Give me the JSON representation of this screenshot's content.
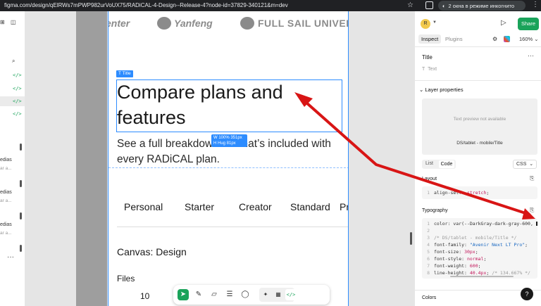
{
  "browser": {
    "url": "figma.com/design/qElRWs7mPWP982urVoUX75/RADiCAL-4-Design--Release-4?node-id=37829-340121&m=dev",
    "incognito_label": "2 окна в режиме инкогнито",
    "star_icon": "star-icon",
    "menu_icon": "kebab-icon"
  },
  "left_panel": {
    "code_icon": "</>",
    "truncated_rows": [
      {
        "title": "edias",
        "sub": "ar a..."
      },
      {
        "title": "edias",
        "sub": "ar a..."
      },
      {
        "title": "edias",
        "sub": "ar a..."
      }
    ]
  },
  "artboard": {
    "logos": [
      "enter",
      "Yanfeng",
      "FULL SAIL UNIVERS"
    ],
    "title_tag": "T Title",
    "title": "Compare plans and features",
    "dimension_badge": {
      "line1": "W 100%  351px",
      "line2": "H  Hug     81px"
    },
    "subtitle": "See a full breakdown of what’s included with every RADiCAL plan.",
    "plans": [
      "Personal",
      "Starter",
      "Creator",
      "Standard",
      "Pr"
    ],
    "canvas_heading": "Canvas: Design",
    "files_heading": "Files",
    "files_value": "10",
    "infinity": "∞"
  },
  "toolbar": {
    "tools": [
      "cursor-icon",
      "pen-icon",
      "ruler-icon",
      "comment-list-icon",
      "comment-icon",
      "ai-icon",
      "component-icon",
      "code-icon"
    ],
    "code_label": "</>"
  },
  "right_panel": {
    "avatar_letter": "R",
    "share_label": "Share",
    "tabs": {
      "inspect": "Inspect",
      "plugins": "Plugins"
    },
    "zoom": "160%",
    "layer_title": "Title",
    "layer_type": "Text",
    "layer_properties": "Layer properties",
    "preview_unavailable": "Text preview not available",
    "preview_name": "DS/tablet - mobile/Title",
    "view_list": "List",
    "view_code": "Code",
    "lang": "CSS",
    "layout_label": "Layout",
    "layout_code": [
      {
        "n": "1",
        "prop": "align-self",
        "val": "stretch"
      }
    ],
    "typography_label": "Typography",
    "typo_code": [
      {
        "n": "1",
        "text": "color: var(--DarkGray-dark-gray-600, "
      },
      {
        "n": "2",
        "text": ""
      },
      {
        "n": "3",
        "text": "/* DS/tablet - mobile/Title */"
      },
      {
        "n": "4",
        "prop": "font-family",
        "val": "\"Avenir Next LT Pro\""
      },
      {
        "n": "5",
        "prop": "font-size",
        "val": "30px"
      },
      {
        "n": "6",
        "prop": "font-style",
        "val": "normal"
      },
      {
        "n": "7",
        "prop": "font-weight",
        "val": "600"
      },
      {
        "n": "8",
        "prop": "line-height",
        "val": "40.4px",
        "comment": "/* 134.667% */"
      }
    ],
    "colors_label": "Colors",
    "help": "?",
    "colors": {
      "accent_green": "#1aa35a",
      "selection_blue": "#2d8cff",
      "annotation_red": "#d81515"
    }
  }
}
